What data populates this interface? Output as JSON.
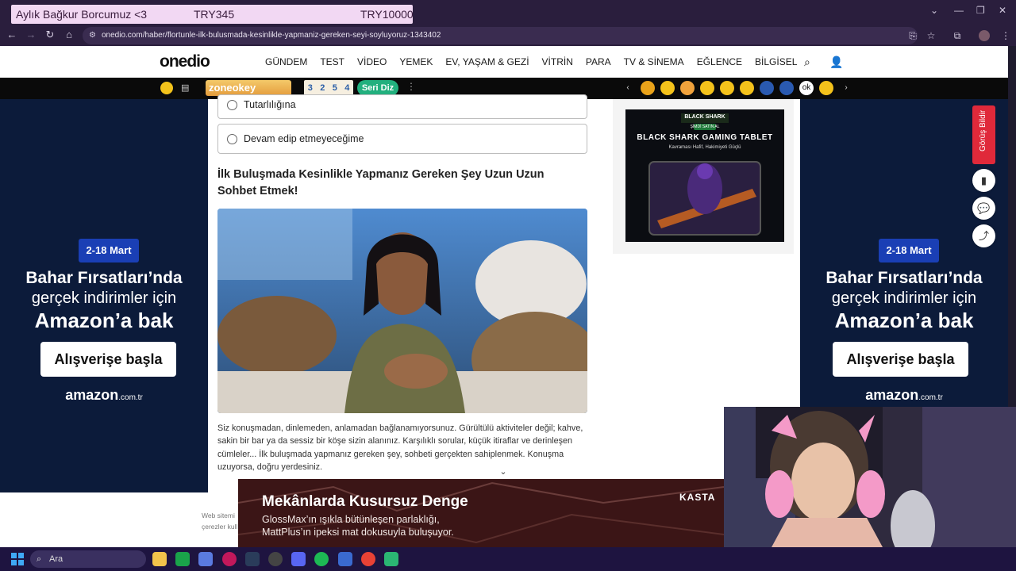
{
  "browser": {
    "stream_overlay": {
      "title": "Aylık Bağkur Borcumuz <3",
      "current": "TRY345",
      "goal": "TRY10000"
    },
    "url": "onedio.com/haber/flortunle-ilk-bulusmada-kesinlikle-yapmaniz-gereken-seyi-soyluyoruz-1343402"
  },
  "site": {
    "logo": "onedio",
    "nav": [
      "GÜNDEM",
      "TEST",
      "VİDEO",
      "YEMEK",
      "EV, YAŞAM & GEZİ",
      "VİTRİN",
      "PARA",
      "TV & SİNEMA",
      "EĞLENCE",
      "BİLGİSEL"
    ],
    "strip": {
      "zone_label": "zoneokey",
      "tiles": [
        "3",
        "2",
        "5",
        "4"
      ],
      "seri_label": "Seri Diz"
    }
  },
  "side_ad": {
    "date": "2-18 Mart",
    "line1": "Bahar Fırsatları’nda",
    "line2": "gerçek indirimler için",
    "line3": "Amazon’a bak",
    "button": "Alışverişe başla",
    "brand": "amazon",
    "brand_suffix": ".com.tr"
  },
  "quiz": {
    "options": [
      "Tutarlılığına",
      "Devam edip etmeyeceğime"
    ]
  },
  "article": {
    "heading": "İlk Buluşmada Kesinlikle Yapmanız Gereken Şey Uzun Uzun Sohbet Etmek!",
    "paragraph": "Siz konuşmadan, dinlemeden, anlamadan bağlanamıyorsunuz. Gürültülü aktiviteler değil; kahve, sakin bir bar ya da sessiz bir köşe sizin alanınız. Karşılıklı sorular, küçük itiraflar ve derinleşen cümleler... İlk buluşmada yapmanız gereken şey, sohbeti gerçekten sahiplenmek. Konuşma uzuyorsa, doğru yerdesiniz."
  },
  "tablet_ad": {
    "brand": "BLACK SHARK",
    "badge": "ŞİMDİ SATIN AL",
    "title": "BLACK SHARK GAMING TABLET",
    "subtitle": "Kavraması Hafif, Hakimiyeti Güçlü"
  },
  "side_tools": {
    "feedback": "Görüş Bildir"
  },
  "bottom_ad": {
    "title": "Mekânlarda Kusursuz Denge",
    "line1": "GlossMax’ın ışıkla bütünleşen parlaklığı,",
    "line2": "MattPlus’ın ipeksi mat dokusuyla buluşuyor.",
    "brand": "KASTA"
  },
  "cookie": {
    "line1": "Web sitemi",
    "line2": "çerezler kull"
  },
  "taskbar": {
    "search_placeholder": "Ara"
  }
}
